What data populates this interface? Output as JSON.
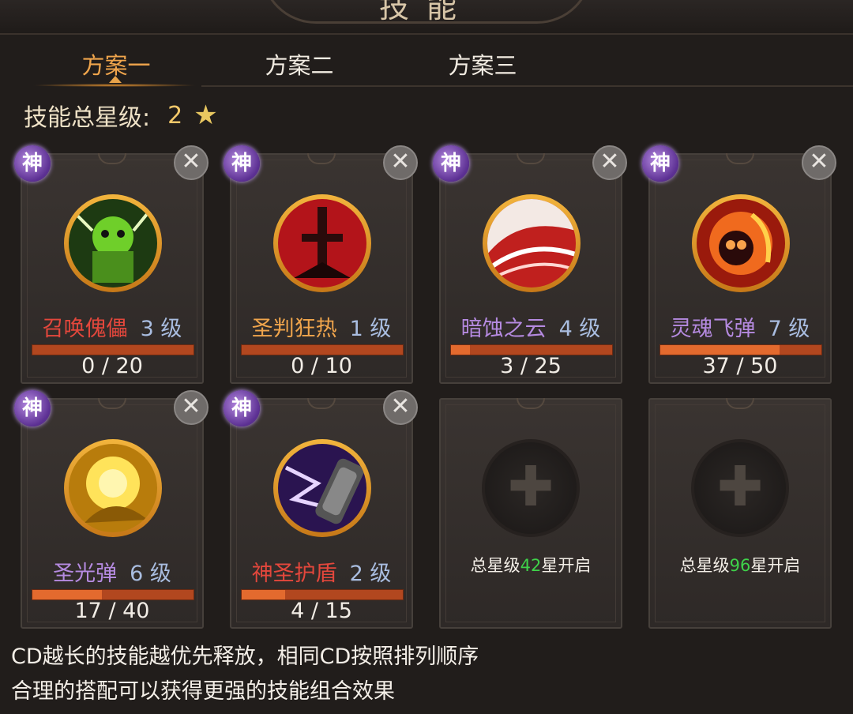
{
  "header": {
    "title": "技能"
  },
  "tabs": [
    {
      "label": "方案一",
      "active": true
    },
    {
      "label": "方案二",
      "active": false
    },
    {
      "label": "方案三",
      "active": false
    }
  ],
  "total_stars": {
    "label": "技能总星级:",
    "value": "2",
    "icon": "star-icon"
  },
  "skills": [
    {
      "name": "召唤傀儡",
      "level": "3 级",
      "progress_text": "0 / 20",
      "progress": 0.0,
      "name_color": "#e3473c",
      "badge": "神",
      "icon": "puppet-icon"
    },
    {
      "name": "圣判狂热",
      "level": "1 级",
      "progress_text": "0 / 10",
      "progress": 0.0,
      "name_color": "#f0a54c",
      "badge": "神",
      "icon": "holy-sword-icon"
    },
    {
      "name": "暗蚀之云",
      "level": "4 级",
      "progress_text": "3 / 25",
      "progress": 0.12,
      "name_color": "#b58ae0",
      "badge": "神",
      "icon": "dark-cloud-icon"
    },
    {
      "name": "灵魂飞弹",
      "level": "7 级",
      "progress_text": "37 / 50",
      "progress": 0.74,
      "name_color": "#b58ae0",
      "badge": "神",
      "icon": "flaming-skull-icon"
    },
    {
      "name": "圣光弹",
      "level": "6 级",
      "progress_text": "17 / 40",
      "progress": 0.425,
      "name_color": "#b58ae0",
      "badge": "神",
      "icon": "holy-light-icon"
    },
    {
      "name": "神圣护盾",
      "level": "2 级",
      "progress_text": "4 / 15",
      "progress": 0.267,
      "name_color": "#e3473c",
      "badge": "神",
      "icon": "lightning-shield-icon"
    }
  ],
  "locked_slots": [
    {
      "prefix": "总星级",
      "stars": "42",
      "suffix": "星开启",
      "icon": "plus-icon"
    },
    {
      "prefix": "总星级",
      "stars": "96",
      "suffix": "星开启",
      "icon": "plus-icon"
    }
  ],
  "close_symbol": "✕",
  "plus_symbol": "✚",
  "star_symbol": "★",
  "footer": {
    "line1": "CD越长的技能越优先释放，相同CD按照排列顺序",
    "line2": "合理的搭配可以获得更强的技能组合效果"
  }
}
